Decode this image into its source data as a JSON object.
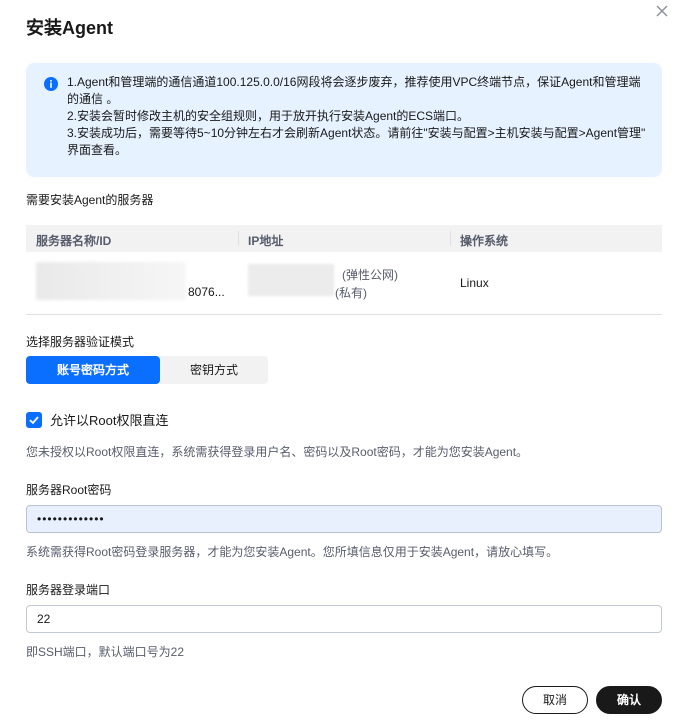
{
  "dialog": {
    "title": "安装Agent",
    "notice": {
      "lines": [
        "1.Agent和管理端的通信通道100.125.0.0/16网段将会逐步废弃，推荐使用VPC终端节点，保证Agent和管理端",
        "的通信 。",
        "2.安装会暂时修改主机的安全组规则，用于放开执行安装Agent的ECS端口。",
        "3.安装成功后，需要等待5~10分钟左右才会刷新Agent状态。请前往\"安装与配置>主机安装与配置>Agent管理\"",
        "界面查看。"
      ]
    },
    "servers_label": "需要安装Agent的服务器",
    "table": {
      "headers": [
        "服务器名称/ID",
        "IP地址",
        "操作系统"
      ],
      "row": {
        "name_suffix": "8076...",
        "ip_public": "(弹性公网)",
        "ip_private": "(私有)",
        "os": "Linux"
      }
    },
    "auth_mode_label": "选择服务器验证模式",
    "auth_modes": [
      "账号密码方式",
      "密钥方式"
    ],
    "auth_mode_selected": "账号密码方式",
    "root_checkbox_label": "允许以Root权限直连",
    "root_hint": "您未授权以Root权限直连，系统需获得登录用户名、密码以及Root密码，才能为您安装Agent。",
    "root_password_label": "服务器Root密码",
    "root_password_value": "•••••••••••••",
    "root_password_hint": "系统需获得Root密码登录服务器，才能为您安装Agent。您所填信息仅用于安装Agent，请放心填写。",
    "port_label": "服务器登录端口",
    "port_value": "22",
    "port_hint": "即SSH端口，默认端口号为22",
    "cancel_label": "取消",
    "confirm_label": "确认"
  },
  "colors": {
    "primary": "#0a6fff",
    "notice_bg": "#e6f2ff",
    "dark_button": "#191919"
  }
}
